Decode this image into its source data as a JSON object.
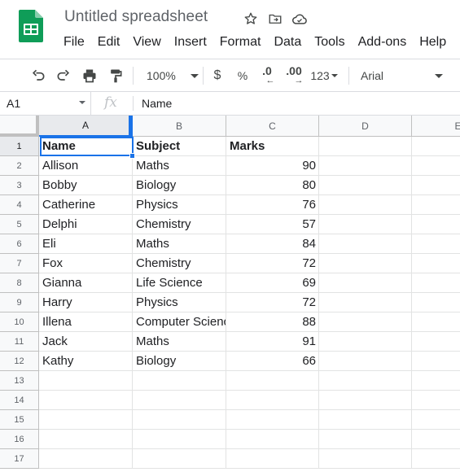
{
  "app": {
    "title": "Untitled spreadsheet",
    "logo_icon": "google-sheets-logo",
    "title_icons": [
      "star-icon",
      "move-to-folder-icon",
      "cloud-status-icon"
    ]
  },
  "menu": [
    "File",
    "Edit",
    "View",
    "Insert",
    "Format",
    "Data",
    "Tools",
    "Add-ons",
    "Help"
  ],
  "toolbar": {
    "zoom": "100%",
    "currency": "$",
    "percent": "%",
    "decrease_decimal": ".0",
    "increase_decimal": ".00",
    "more_formats": "123",
    "font": "Arial",
    "icons": [
      "undo-icon",
      "redo-icon",
      "print-icon",
      "paint-format-icon"
    ]
  },
  "formula_bar": {
    "cell_ref": "A1",
    "fx_label": "fx",
    "value": "Name"
  },
  "columns": [
    "A",
    "B",
    "C",
    "D",
    "E"
  ],
  "row_numbers": [
    "1",
    "2",
    "3",
    "4",
    "5",
    "6",
    "7",
    "8",
    "9",
    "10",
    "11",
    "12",
    "13",
    "14",
    "15",
    "16",
    "17"
  ],
  "table": {
    "headers": [
      "Name",
      "Subject",
      "Marks"
    ],
    "rows": [
      [
        "Allison",
        "Maths",
        "90"
      ],
      [
        "Bobby",
        "Biology",
        "80"
      ],
      [
        "Catherine",
        "Physics",
        "76"
      ],
      [
        "Delphi",
        "Chemistry",
        "57"
      ],
      [
        "Eli",
        "Maths",
        "84"
      ],
      [
        "Fox",
        "Chemistry",
        "72"
      ],
      [
        "Gianna",
        "Life Science",
        "69"
      ],
      [
        "Harry",
        "Physics",
        "72"
      ],
      [
        "Illena",
        "Computer Science",
        "88"
      ],
      [
        "Jack",
        "Maths",
        "91"
      ],
      [
        "Kathy",
        "Biology",
        "66"
      ]
    ]
  },
  "colors": {
    "accent": "#1a73e8",
    "sheets_green": "#0f9d58",
    "grid_line": "#e2e3e3",
    "header_bg": "#f8f9fa"
  }
}
